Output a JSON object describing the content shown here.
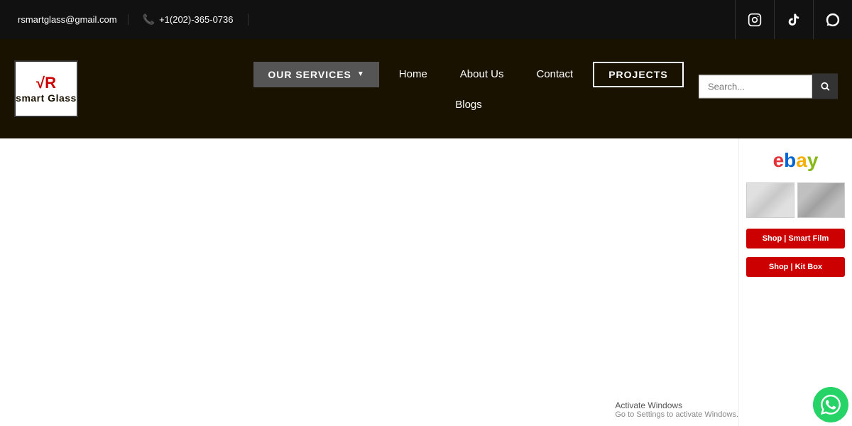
{
  "topbar": {
    "email": "rsmartglass@gmail.com",
    "phone": "+1(202)-365-0736",
    "social": [
      {
        "name": "instagram",
        "icon": "⊙"
      },
      {
        "name": "tiktok",
        "icon": "♪"
      },
      {
        "name": "whatsapp-top",
        "icon": "◉"
      }
    ]
  },
  "nav": {
    "logo": {
      "vr": "√R",
      "text": "smart Glass"
    },
    "services_label": "OUR SERVICES",
    "links": [
      {
        "label": "Home",
        "name": "home"
      },
      {
        "label": "About Us",
        "name": "about"
      },
      {
        "label": "Contact",
        "name": "contact"
      },
      {
        "label": "PROJECTS",
        "name": "projects"
      },
      {
        "label": "Blogs",
        "name": "blogs"
      }
    ],
    "search_placeholder": "Search..."
  },
  "sidebar": {
    "ebay_label": "ebay",
    "shop_btn1": "Shop | Smart Film",
    "shop_btn2": "Shop | Kit Box"
  },
  "activate": {
    "title": "Activate Windows",
    "sub": "Go to Settings to activate Windows."
  }
}
